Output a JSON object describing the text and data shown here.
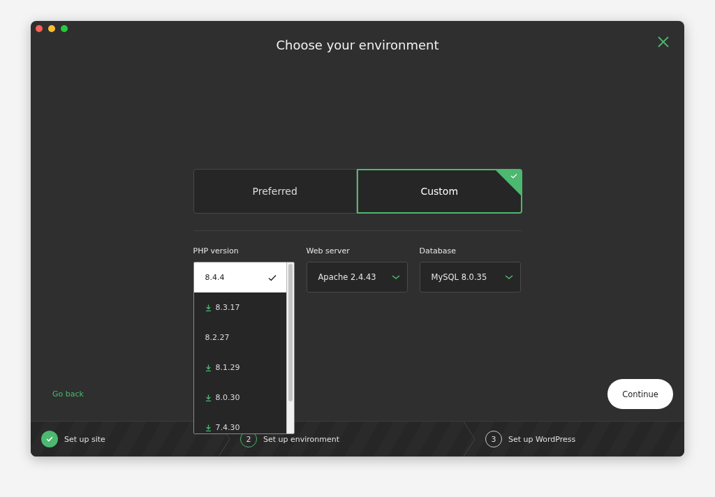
{
  "window": {
    "title": "Choose your environment"
  },
  "modes": [
    {
      "label": "Preferred",
      "selected": false
    },
    {
      "label": "Custom",
      "selected": true
    }
  ],
  "selects": [
    {
      "label": "PHP version",
      "expanded": true,
      "options": [
        {
          "label": "8.4.4",
          "selected": true,
          "needs_download": false
        },
        {
          "label": "8.3.17",
          "selected": false,
          "needs_download": true
        },
        {
          "label": "8.2.27",
          "selected": false,
          "needs_download": false
        },
        {
          "label": "8.1.29",
          "selected": false,
          "needs_download": true
        },
        {
          "label": "8.0.30",
          "selected": false,
          "needs_download": true
        },
        {
          "label": "7.4.30",
          "selected": false,
          "needs_download": true
        }
      ]
    },
    {
      "label": "Web server",
      "expanded": false,
      "value": "Apache 2.4.43"
    },
    {
      "label": "Database",
      "expanded": false,
      "value": "MySQL 8.0.35"
    }
  ],
  "actions": {
    "back": "Go back",
    "next": "Continue"
  },
  "steps": [
    {
      "kind": "done",
      "label": "Set up site"
    },
    {
      "kind": "current",
      "number": "2",
      "label": "Set up environment"
    },
    {
      "kind": "pending",
      "number": "3",
      "label": "Set up WordPress"
    }
  ]
}
